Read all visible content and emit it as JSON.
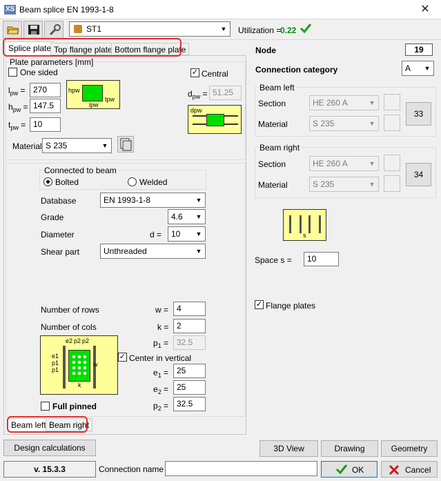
{
  "window": {
    "title": "Beam splice EN 1993-1-8",
    "app_icon": "XS",
    "close": "✕"
  },
  "toolbar": {
    "connection": "ST1",
    "utilization_label": "Utilization =",
    "utilization_value": "0.22",
    "utilization_color": "#0a8a0a"
  },
  "tabs": [
    "Splice plate",
    "Top flange plate",
    "Bottom flange plate"
  ],
  "plate": {
    "group_label": "Plate parameters [mm]",
    "one_sided": "One sided",
    "central": "Central",
    "l_label": "l",
    "l_sub": "pw",
    "l_eq": "=",
    "l_value": "270",
    "h_label": "h",
    "h_sub": "pw",
    "h_eq": "=",
    "h_value": "147.5",
    "t_label": "t",
    "t_sub": "pw",
    "t_eq": "=",
    "t_value": "10",
    "d_label": "d",
    "d_sub": "pw",
    "d_eq": "=",
    "d_value": "51.25",
    "material_label": "Material",
    "material_value": "S 235",
    "fig1_h": "hpw",
    "fig1_l": "lpw",
    "fig1_t": "tpw",
    "fig2_d": "dpw"
  },
  "connected": {
    "group_label": "Connected to beam",
    "bolted": "Bolted",
    "welded": "Welded",
    "database_label": "Database",
    "database_value": "EN 1993-1-8",
    "grade_label": "Grade",
    "grade_value": "4.6",
    "diameter_label": "Diameter",
    "diameter_eq": "d =",
    "diameter_value": "10",
    "shear_label": "Shear part",
    "shear_value": "Unthreaded",
    "rows_label": "Number of rows",
    "rows_eq": "w =",
    "rows_value": "4",
    "cols_label": "Number of cols",
    "cols_eq": "k =",
    "cols_value": "2",
    "p1_label": "p",
    "p1_sub": "1",
    "p1_eq": "=",
    "p1_value": "32.5",
    "center_vertical": "Center in vertical",
    "e1_label": "e",
    "e1_sub": "1",
    "e1_eq": "=",
    "e1_value": "25",
    "e2_label": "e",
    "e2_sub": "2",
    "e2_eq": "=",
    "e2_value": "25",
    "p2_label": "p",
    "p2_sub": "2",
    "p2_eq": "=",
    "p2_value": "32.5",
    "full_pinned": "Full pinned",
    "fig_e2": "e2",
    "fig_p2a": "p2",
    "fig_p2b": "p2",
    "fig_e1": "e1",
    "fig_p1a": "p1",
    "fig_p1b": "p1",
    "fig_w": "w",
    "fig_k": "k"
  },
  "beam_tabs": [
    "Beam left",
    "Beam right"
  ],
  "right": {
    "node_label": "Node",
    "node_value": "19",
    "category_label": "Connection category",
    "category_value": "A",
    "beam_left": {
      "label": "Beam left",
      "section_label": "Section",
      "section_value": "HE  260 A",
      "material_label": "Material",
      "material_value": "S 235",
      "id": "33"
    },
    "beam_right": {
      "label": "Beam right",
      "section_label": "Section",
      "section_value": "HE  260 A",
      "material_label": "Material",
      "material_value": "S 235",
      "id": "34"
    },
    "space_label": "Space s =",
    "space_value": "10",
    "space_fig_s": "s",
    "flange_plates": "Flange plates"
  },
  "buttons": {
    "design": "Design calculations",
    "view3d": "3D View",
    "drawing": "Drawing",
    "geometry": "Geometry",
    "ok": "OK",
    "cancel": "Cancel"
  },
  "footer": {
    "version": "v. 15.3.3",
    "connection_name_label": "Connection name",
    "connection_name_value": ""
  },
  "colors": {
    "accent_red": "#e03030",
    "figure_yellow": "#ffff99",
    "figure_green": "#00dd00",
    "ok_green": "#1a9a1a",
    "cancel_red": "#d01818"
  }
}
